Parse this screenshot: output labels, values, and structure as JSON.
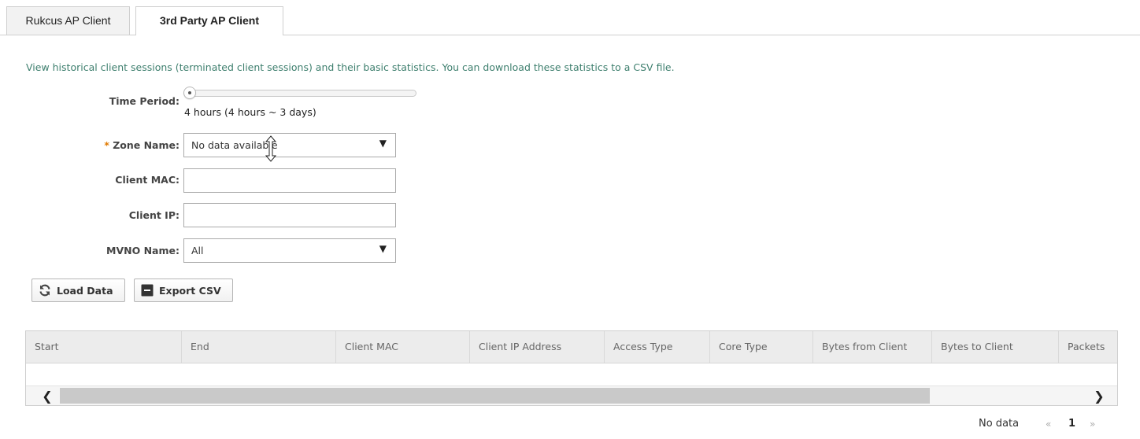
{
  "tabs": [
    {
      "label": "Rukcus AP Client",
      "active": false
    },
    {
      "label": "3rd Party AP Client",
      "active": true
    }
  ],
  "intro_text": "View historical client sessions (terminated client sessions) and their basic statistics. You can download these statistics to a CSV file.",
  "form": {
    "time_period_label": "Time Period:",
    "time_period_value_text": "4 hours (4 hours ~ 3 days)",
    "slider_position_fraction": 0,
    "zone_required_marker": "*",
    "zone_label": "Zone Name:",
    "zone_value": "No data available",
    "client_mac_label": "Client MAC:",
    "client_mac_value": "",
    "client_ip_label": "Client IP:",
    "client_ip_value": "",
    "mvno_label": "MVNO Name:",
    "mvno_value": "All"
  },
  "buttons": {
    "load": "Load Data",
    "export": "Export CSV"
  },
  "table": {
    "columns": [
      "Start",
      "End",
      "Client MAC",
      "Client IP Address",
      "Access Type",
      "Core Type",
      "Bytes from Client",
      "Bytes to Client",
      "Packets"
    ],
    "rows": []
  },
  "pager": {
    "status": "No data",
    "prev": "«",
    "page": "1",
    "next": "»"
  },
  "colors": {
    "intro_text": "#3e7f6e",
    "required_marker": "#e07a00",
    "table_header_bg": "#ececec"
  },
  "icons": {
    "load": "refresh-icon",
    "export": "export-icon",
    "dropdown": "dropdown-arrow-icon"
  }
}
